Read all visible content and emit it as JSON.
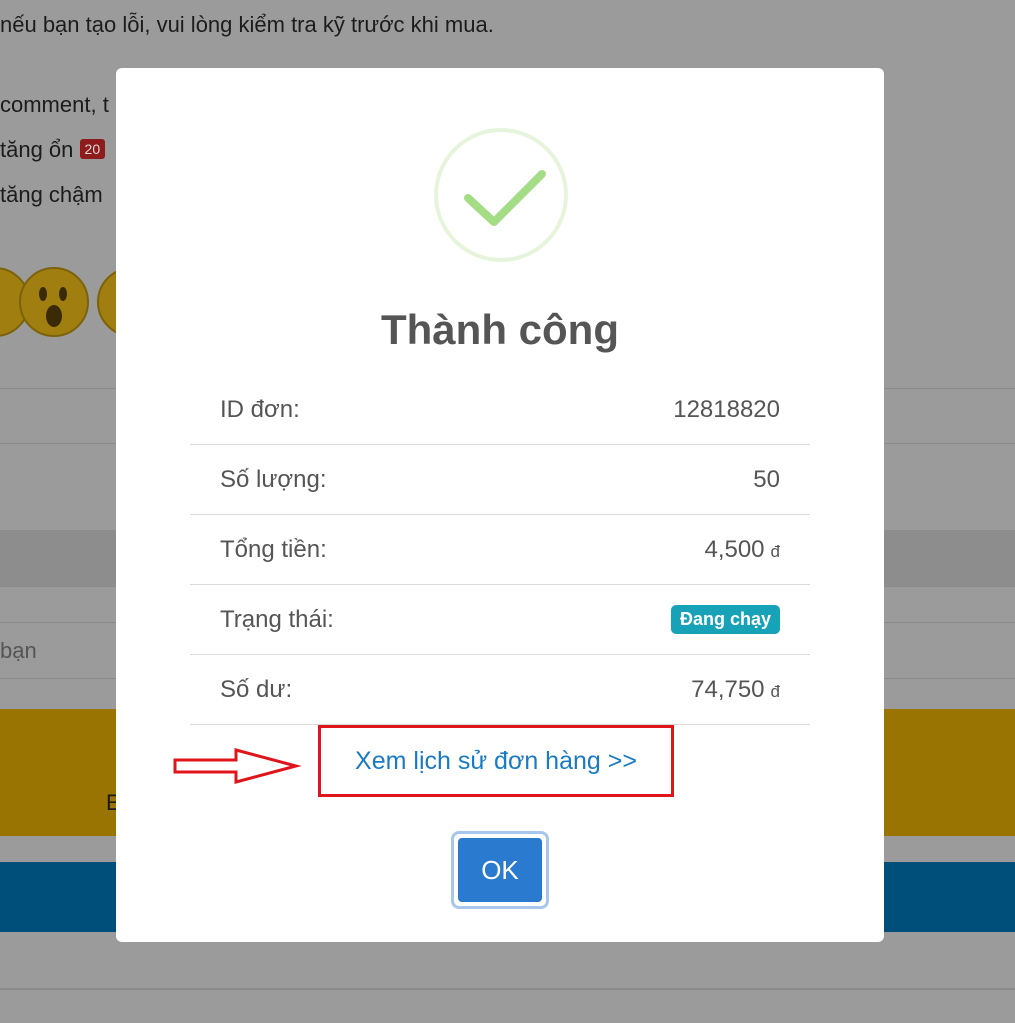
{
  "background": {
    "line1": "nếu bạn tạo lỗi, vui lòng kiểm tra kỹ trước khi mua.",
    "line2": "comment, t",
    "line3": "tăng ổn",
    "line3_badge": "20",
    "line4": "tăng chậm",
    "placeholder": "bạn",
    "yellow_letter": "E"
  },
  "modal": {
    "icon": "checkmark-icon",
    "title": "Thành công",
    "rows": [
      {
        "label": "ID đơn:",
        "value": "12818820"
      },
      {
        "label": "Số lượng:",
        "value": "50"
      },
      {
        "label": "Tổng tiền:",
        "value": "4,500",
        "currency": "đ"
      },
      {
        "label": "Trạng thái:",
        "badge": "Đang chạy"
      },
      {
        "label": "Số dư:",
        "value": "74,750",
        "currency": "đ"
      }
    ],
    "history_link": "Xem lịch sử đơn hàng >>",
    "ok_label": "OK"
  },
  "colors": {
    "success": "#a5dc86",
    "status_badge": "#17a2b8",
    "ok_button": "#2a7bcf",
    "highlight_box": "#e0151c",
    "link": "#1a7bc4"
  }
}
